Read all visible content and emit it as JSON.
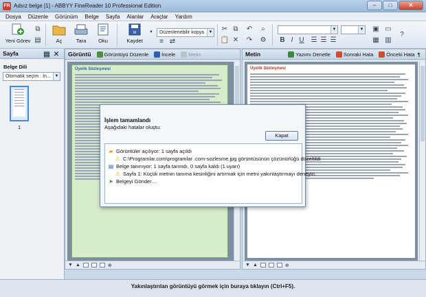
{
  "window": {
    "title": "Adsız belge [1] - ABBYY FineReader 10 Professional Edition",
    "app_icon": "FR"
  },
  "window_buttons": {
    "minimize": "–",
    "maximize": "□",
    "close": "✕"
  },
  "menu": [
    "Dosya",
    "Düzenle",
    "Görünüm",
    "Belge",
    "Sayfa",
    "Alanlar",
    "Araçlar",
    "Yardım"
  ],
  "toolbar": {
    "new_task": "Yeni Görev",
    "open": "Aç",
    "scan": "Tara",
    "read": "Oku",
    "save": "Kaydet",
    "save_format": "Düzenlenebilir kopya"
  },
  "sidebar": {
    "header": "Sayfa",
    "language_label": "Belge Dili",
    "language_value": "Otomatik seçim : İn...",
    "page_number": "1"
  },
  "image_panel": {
    "header": "Görüntü",
    "edit_image": "Görüntüyü Düzenle",
    "inspect": "İncele",
    "text_tool": "Metin",
    "doc_title": "Üyelik Sözleşmesi"
  },
  "text_panel": {
    "header": "Metin",
    "spell_check": "Yazımı Denetle",
    "next_error": "Sonraki Hata",
    "prev_error": "Önceki Hata",
    "pilcrow": "¶",
    "doc_title": "Üyelik Sözleşmesi"
  },
  "statusbar": {
    "text": "Yakınlaştırılan görüntüyü görmek için buraya tıklayın (Ctrl+F5)."
  },
  "dialog": {
    "title": "İşlem tamamlandı",
    "subtitle": "Aşağıdaki hatalar oluştu:",
    "close_button": "Kapat",
    "log": [
      {
        "text": "Görüntüler açılıyor: 1 sayfa açıldı",
        "icon": "folder-icon",
        "indent": 0
      },
      {
        "text": "C:\\Programlar.com\\programlar .com-sozlesme.jpg görüntüsünün çözünürlüğü düzeltildi",
        "icon": "warning-icon",
        "indent": 1
      },
      {
        "text": "Belge tanınıyor: 1 sayfa tanındı, 0 sayfa kaldı (1 uyarı)",
        "icon": "page-icon",
        "indent": 0
      },
      {
        "text": "Sayfa 1: Küçük metnin tanıma kesinliğini artırmak için metni yakınlaştırmayı deneyin.",
        "icon": "warning-icon",
        "indent": 1
      },
      {
        "text": "Belgeyi Gönder…",
        "icon": "send-icon",
        "indent": 0
      }
    ]
  },
  "colors": {
    "accent": "#2a5fb0",
    "warning": "#e8b400",
    "page_bg": "#7d8fa1",
    "highlight": "#d7ecc9"
  }
}
